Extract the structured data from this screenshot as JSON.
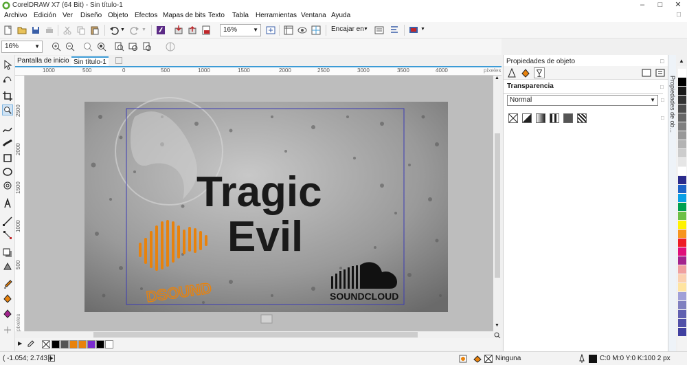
{
  "window": {
    "title": "CorelDRAW X7 (64 Bit) - Sin título-1"
  },
  "menu": [
    "Archivo",
    "Edición",
    "Ver",
    "Diseño",
    "Objeto",
    "Efectos",
    "Mapas de bits",
    "Texto",
    "Tabla",
    "Herramientas",
    "Ventana",
    "Ayuda"
  ],
  "toolbar": {
    "zoom_value": "16%",
    "snap_label": "Encajar en"
  },
  "propbar": {
    "zoom_value": "16%"
  },
  "tabs": {
    "home": "Pantalla de inicio",
    "doc": "Sin título-1"
  },
  "ruler": {
    "unit": "píxeles",
    "h_labels": [
      "1000",
      "500",
      "0",
      "500",
      "1000",
      "1500",
      "2000",
      "2500",
      "3000",
      "3500",
      "4000"
    ],
    "v_labels": [
      "2500",
      "2000",
      "1500",
      "1000",
      "500"
    ],
    "v_unit": "píxeles"
  },
  "artwork": {
    "title_line1": "Tragic",
    "title_line2": "Evil",
    "logo_left": "DSOUND",
    "logo_right": "SOUNDCLOUD"
  },
  "docker": {
    "title": "Propiedades de objeto",
    "section": "Transparencia",
    "mode": "Normal",
    "vertical_tab": "Propiedades de ob..."
  },
  "status": {
    "coords": "( -1.054; 2.743 )",
    "fill_none": "Ninguna",
    "outline": "C:0 M:0 Y:0 K:100  2 px"
  },
  "colors": {
    "accent": "#3c9bd6",
    "page_border": "#3b3bb4",
    "orange": "#e8820c"
  },
  "bottom_palette": [
    "#000000",
    "#555555",
    "#e8820c",
    "#e8820c",
    "#7a2bd0",
    "#000000",
    "#ffffff"
  ],
  "right_palette": [
    "#ffffff",
    "#000000",
    "#1a1a1a",
    "#333333",
    "#4d4d4d",
    "#666666",
    "#808080",
    "#999999",
    "#b3b3b3",
    "#cccccc",
    "#e6e6e6",
    "#ffffff",
    "#2b2b8c",
    "#1e64c8",
    "#0aa0e6",
    "#00a050",
    "#6dc046",
    "#fff200",
    "#f7941d",
    "#ee1c25",
    "#e0107a",
    "#a3238e",
    "#f0a0a0",
    "#fbd0b0",
    "#ffe4a0",
    "#a0a0d8",
    "#8080c0",
    "#6060b0",
    "#5050a8",
    "#4040a0"
  ]
}
